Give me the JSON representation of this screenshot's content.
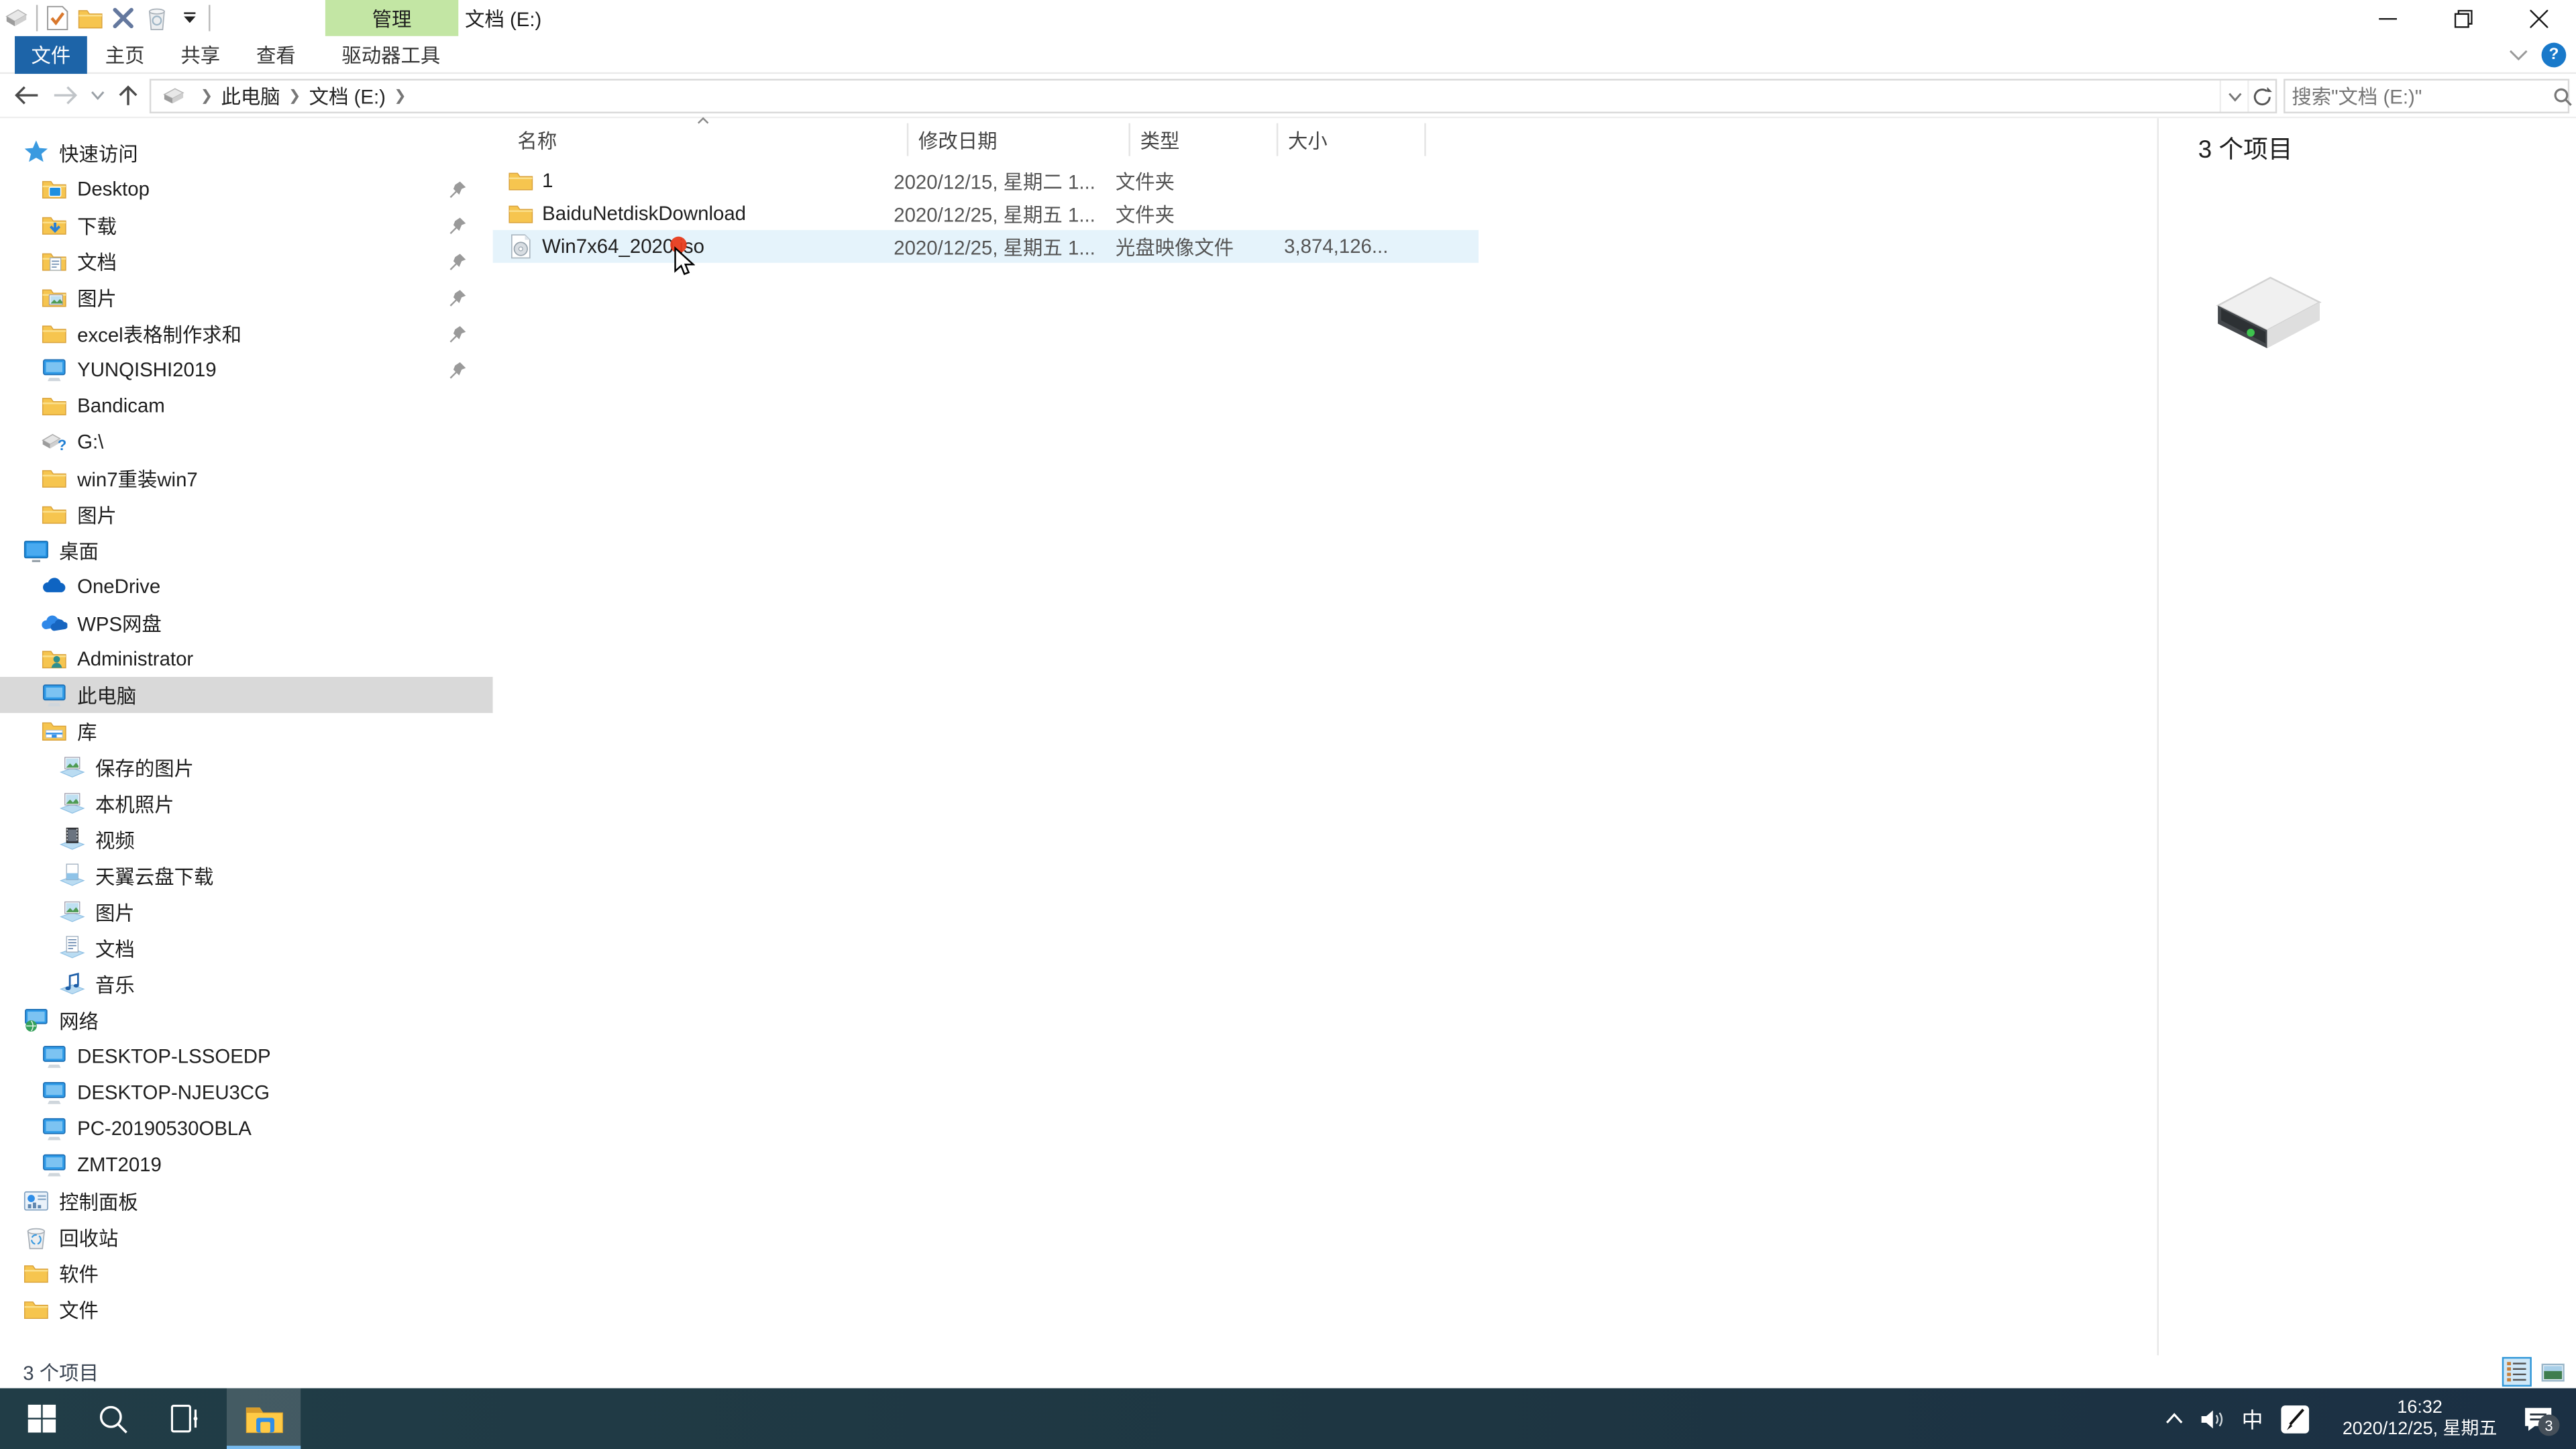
{
  "window": {
    "title": "文档 (E:)"
  },
  "ribbon": {
    "manage_label": "管理",
    "tab_file": "文件",
    "tab_home": "主页",
    "tab_share": "共享",
    "tab_view": "查看",
    "tab_drive_tools": "驱动器工具"
  },
  "address": {
    "crumbs": [
      "此电脑",
      "文档 (E:)"
    ],
    "search_placeholder": "搜索\"文档 (E:)\""
  },
  "sidebar": {
    "items": [
      {
        "label": "快速访问",
        "icon": "quick-access-star",
        "level": 0,
        "pinned": false
      },
      {
        "label": "Desktop",
        "icon": "folder-desktop",
        "level": 1,
        "pinned": true
      },
      {
        "label": "下载",
        "icon": "folder-download",
        "level": 1,
        "pinned": true
      },
      {
        "label": "文档",
        "icon": "folder-documents",
        "level": 1,
        "pinned": true
      },
      {
        "label": "图片",
        "icon": "folder-pictures",
        "level": 1,
        "pinned": true
      },
      {
        "label": "excel表格制作求和",
        "icon": "folder",
        "level": 1,
        "pinned": true
      },
      {
        "label": "YUNQISHI2019",
        "icon": "computer",
        "level": 1,
        "pinned": true
      },
      {
        "label": "Bandicam",
        "icon": "folder",
        "level": 1,
        "pinned": false
      },
      {
        "label": "G:\\",
        "icon": "usb-drive",
        "level": 1,
        "pinned": false
      },
      {
        "label": "win7重装win7",
        "icon": "folder",
        "level": 1,
        "pinned": false
      },
      {
        "label": "图片",
        "icon": "folder",
        "level": 1,
        "pinned": false
      },
      {
        "label": "桌面",
        "icon": "desktop",
        "level": 0,
        "pinned": false
      },
      {
        "label": "OneDrive",
        "icon": "onedrive-cloud",
        "level": 1,
        "pinned": false
      },
      {
        "label": "WPS网盘",
        "icon": "wps-cloud",
        "level": 1,
        "pinned": false
      },
      {
        "label": "Administrator",
        "icon": "folder-user",
        "level": 1,
        "pinned": false
      },
      {
        "label": "此电脑",
        "icon": "this-pc",
        "level": 1,
        "pinned": false,
        "selected": true
      },
      {
        "label": "库",
        "icon": "libraries",
        "level": 1,
        "pinned": false
      },
      {
        "label": "保存的图片",
        "icon": "library-pictures",
        "level": 2,
        "pinned": false
      },
      {
        "label": "本机照片",
        "icon": "library-pictures",
        "level": 2,
        "pinned": false
      },
      {
        "label": "视频",
        "icon": "library-videos",
        "level": 2,
        "pinned": false
      },
      {
        "label": "天翼云盘下载",
        "icon": "library-downloads",
        "level": 2,
        "pinned": false
      },
      {
        "label": "图片",
        "icon": "library-pictures",
        "level": 2,
        "pinned": false
      },
      {
        "label": "文档",
        "icon": "library-documents",
        "level": 2,
        "pinned": false
      },
      {
        "label": "音乐",
        "icon": "library-music",
        "level": 2,
        "pinned": false
      },
      {
        "label": "网络",
        "icon": "network",
        "level": 0,
        "pinned": false
      },
      {
        "label": "DESKTOP-LSSOEDP",
        "icon": "network-computer",
        "level": 1,
        "pinned": false
      },
      {
        "label": "DESKTOP-NJEU3CG",
        "icon": "network-computer",
        "level": 1,
        "pinned": false
      },
      {
        "label": "PC-20190530OBLA",
        "icon": "network-computer",
        "level": 1,
        "pinned": false
      },
      {
        "label": "ZMT2019",
        "icon": "network-computer",
        "level": 1,
        "pinned": false
      },
      {
        "label": "控制面板",
        "icon": "control-panel",
        "level": 0,
        "pinned": false
      },
      {
        "label": "回收站",
        "icon": "recycle-bin",
        "level": 0,
        "pinned": false
      },
      {
        "label": "软件",
        "icon": "folder",
        "level": 0,
        "pinned": false
      },
      {
        "label": "文件",
        "icon": "folder",
        "level": 0,
        "pinned": false
      }
    ]
  },
  "files": {
    "columns": [
      "名称",
      "修改日期",
      "类型",
      "大小"
    ],
    "rows": [
      {
        "name": "1",
        "date": "2020/12/15, 星期二 1...",
        "type": "文件夹",
        "size": "",
        "icon": "folder",
        "selected": false
      },
      {
        "name": "BaiduNetdiskDownload",
        "date": "2020/12/25, 星期五 1...",
        "type": "文件夹",
        "size": "",
        "icon": "folder",
        "selected": false
      },
      {
        "name": "Win7x64_2020.iso",
        "date": "2020/12/25, 星期五 1...",
        "type": "光盘映像文件",
        "size": "3,874,126...",
        "icon": "disc-image",
        "selected": true
      }
    ]
  },
  "preview": {
    "items_count": "3 个项目"
  },
  "statusbar": {
    "items_count": "3 个项目"
  },
  "taskbar": {
    "ime_mode": "中",
    "time": "16:32",
    "date": "2020/12/25, 星期五",
    "notification_count": "3"
  },
  "icons": {
    "quick-access-star": "blue pushpin star",
    "pin": "gray pin",
    "search": "magnifier",
    "refresh": "circular arrow",
    "back": "left arrow",
    "forward": "right arrow",
    "up": "up arrow",
    "help": "? in blue circle",
    "minimize": "–",
    "maximize": "❐",
    "close": "✕",
    "sort-ascending": "^"
  },
  "colors": {
    "manage_tab_green": "#c3e6a4",
    "file_tab_blue": "#1d64a8",
    "row_selected": "#e5f3fb",
    "sidebar_selected": "#d9d9d9",
    "taskbar": "#1e3642",
    "taskbar_accent_underline": "#76b9ed"
  }
}
